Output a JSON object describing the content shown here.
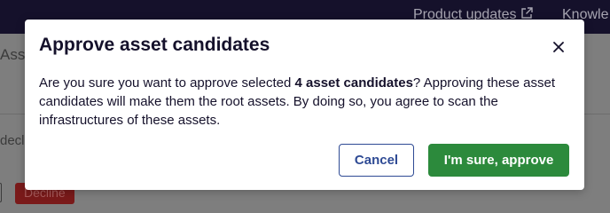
{
  "topbar": {
    "product_updates_label": "Product updates",
    "knowledge_label": "Knowle"
  },
  "background": {
    "heading_fragment": "Ass",
    "filter_fragment": "decl",
    "decline_label": "Decline"
  },
  "modal": {
    "title": "Approve asset candidates",
    "body_prefix": "Are you sure you want to approve selected ",
    "body_bold": "4 asset candidates",
    "body_suffix": "? Approving these asset candidates will make them the root assets. By doing so, you agree to scan the infrastructures of these assets.",
    "cancel_label": "Cancel",
    "approve_label": "I'm sure, approve"
  },
  "colors": {
    "topbar_bg": "#15112b",
    "overlay_bg": "#7e7e7e",
    "primary_outline": "#2e4a94",
    "approve_green": "#2c8a3c",
    "decline_red": "#7a1a1a"
  },
  "icons": {
    "external_link": "external-link-icon",
    "close": "close-icon"
  }
}
